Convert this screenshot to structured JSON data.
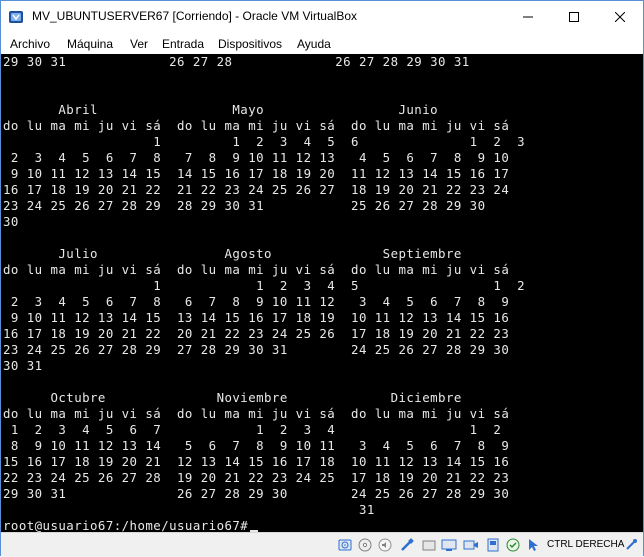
{
  "window": {
    "title": "MV_UBUNTUSERVER67 [Corriendo] - Oracle VM VirtualBox"
  },
  "menu": {
    "items": [
      "Archivo",
      "Máquina",
      "Ver",
      "Entrada",
      "Dispositivos",
      "Ayuda"
    ]
  },
  "terminal": {
    "lines": [
      "29 30 31             26 27 28             26 27 28 29 30 31",
      "",
      "",
      "       Abril                 Mayo                 Junio",
      "do lu ma mi ju vi sá  do lu ma mi ju vi sá  do lu ma mi ju vi sá",
      "                   1         1  2  3  4  5  6              1  2  3",
      " 2  3  4  5  6  7  8   7  8  9 10 11 12 13   4  5  6  7  8  9 10",
      " 9 10 11 12 13 14 15  14 15 16 17 18 19 20  11 12 13 14 15 16 17",
      "16 17 18 19 20 21 22  21 22 23 24 25 26 27  18 19 20 21 22 23 24",
      "23 24 25 26 27 28 29  28 29 30 31           25 26 27 28 29 30",
      "30",
      "",
      "       Julio                Agosto              Septiembre",
      "do lu ma mi ju vi sá  do lu ma mi ju vi sá  do lu ma mi ju vi sá",
      "                   1            1  2  3  4  5                 1  2",
      " 2  3  4  5  6  7  8   6  7  8  9 10 11 12   3  4  5  6  7  8  9",
      " 9 10 11 12 13 14 15  13 14 15 16 17 18 19  10 11 12 13 14 15 16",
      "16 17 18 19 20 21 22  20 21 22 23 24 25 26  17 18 19 20 21 22 23",
      "23 24 25 26 27 28 29  27 28 29 30 31        24 25 26 27 28 29 30",
      "30 31",
      "",
      "      Octubre              Noviembre             Diciembre",
      "do lu ma mi ju vi sá  do lu ma mi ju vi sá  do lu ma mi ju vi sá",
      " 1  2  3  4  5  6  7            1  2  3  4                 1  2",
      " 8  9 10 11 12 13 14   5  6  7  8  9 10 11   3  4  5  6  7  8  9",
      "15 16 17 18 19 20 21  12 13 14 15 16 17 18  10 11 12 13 14 15 16",
      "22 23 24 25 26 27 28  19 20 21 22 23 24 25  17 18 19 20 21 22 23",
      "29 30 31              26 27 28 29 30        24 25 26 27 28 29 30",
      "                                             31",
      ""
    ],
    "prompt": "root@usuario67:/home/usuario67#"
  },
  "statusbar": {
    "host_key": "CTRL DERECHA",
    "icons": [
      "hard-disk-icon",
      "optical-drive-icon",
      "audio-icon",
      "usb-icon",
      "shared-folders-icon",
      "display-icon",
      "video-capture-icon",
      "network-icon",
      "cpu-icon",
      "mouse-integration-icon",
      "keyboard-icon",
      "host-key-icon"
    ]
  },
  "colors": {
    "terminal_bg": "#000000",
    "terminal_fg": "#e8e8e8",
    "accent": "#2f6fd0"
  }
}
